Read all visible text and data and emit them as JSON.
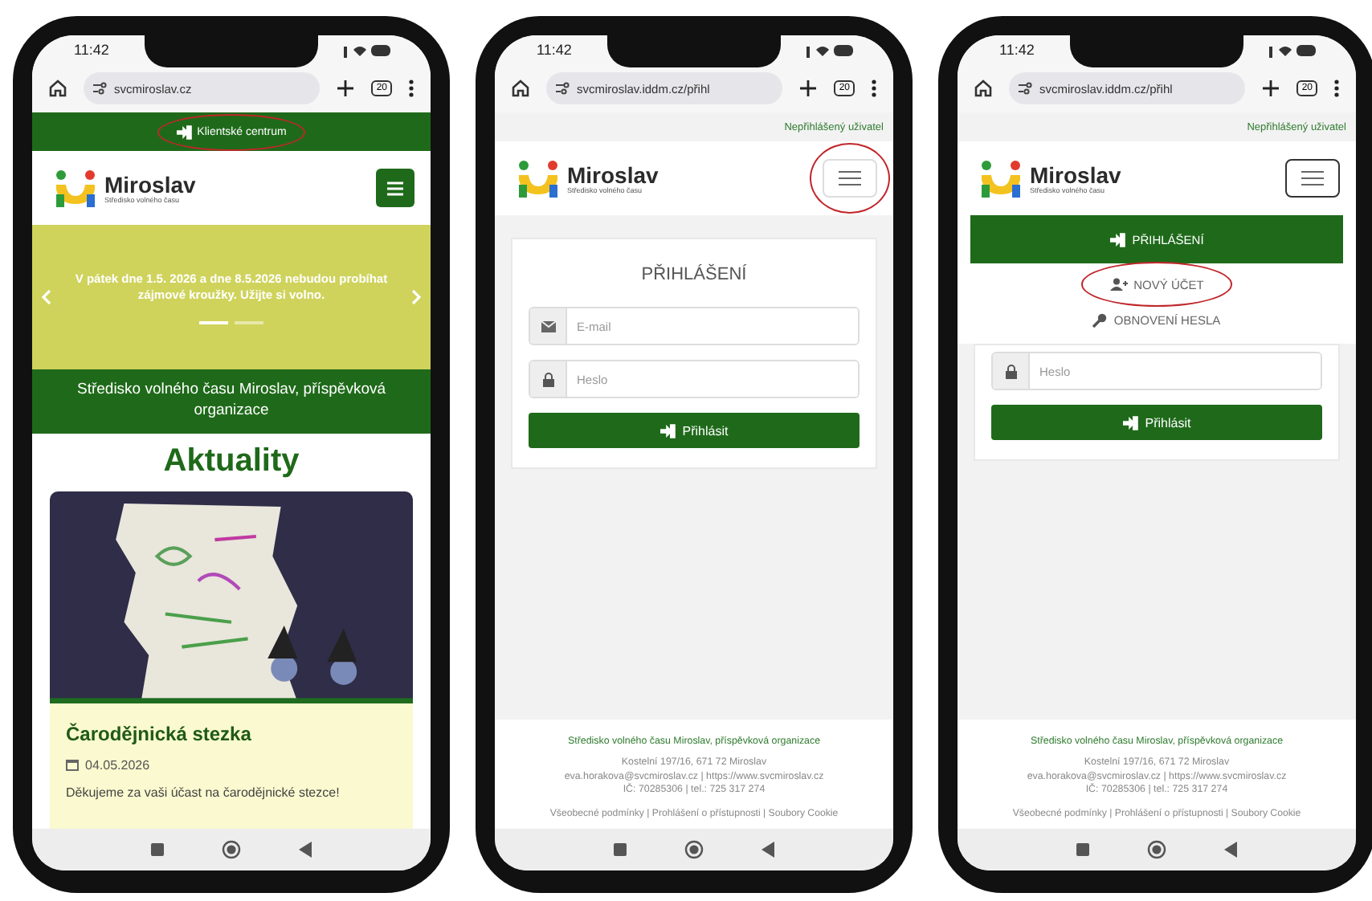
{
  "phones": [
    {
      "kind": "home",
      "time": "11:42",
      "url": "svcmiroslav.cz",
      "tab_count": "20",
      "top_link": {
        "label": "Klientské centrum",
        "highlighted": true
      },
      "logo": {
        "title": "Miroslav",
        "subtitle": "Středisko volného času"
      },
      "menu_button": {
        "highlighted": false
      },
      "banner": {
        "text": "V pátek dne 1.5. 2026 a dne 8.5.2026 nebudou probíhat zájmové kroužky. Užijte si volno.",
        "slides": [
          {
            "selected": true
          },
          {
            "selected": false
          }
        ]
      },
      "org_title": "Středisko volného času Miroslav, příspěvková organizace",
      "section_title": "Aktuality",
      "article": {
        "title": "Čarodějnická stezka",
        "date": "04.05.2026",
        "excerpt": "Děkujeme za vaši účast na čarodějnické stezce!"
      }
    },
    {
      "kind": "login",
      "time": "11:42",
      "url": "svcmiroslav.iddm.cz/přihl",
      "tab_count": "20",
      "user_status": "Nepřihlášený uživatel",
      "logo": {
        "title": "Miroslav",
        "subtitle": "Středisko volného času"
      },
      "menu_button": {
        "highlighted": true
      },
      "form": {
        "title": "PŘIHLÁŠENÍ",
        "fields": [
          {
            "kind": "email",
            "placeholder": "E-mail"
          },
          {
            "kind": "password",
            "placeholder": "Heslo"
          }
        ],
        "submit": "Přihlásit"
      },
      "footer": {
        "org": "Středisko volného času Miroslav, příspěvková organizace",
        "lines": [
          "Kostelní 197/16, 671 72 Miroslav",
          "eva.horakova@svcmiroslav.cz | https://www.svcmiroslav.cz",
          "IČ: 70285306 | tel.: 725 317 274"
        ],
        "links": "Všeobecné podmínky | Prohlášení o přístupnosti | Soubory Cookie"
      }
    },
    {
      "kind": "login",
      "time": "11:42",
      "url": "svcmiroslav.iddm.cz/přihl",
      "tab_count": "20",
      "user_status": "Nepřihlášený uživatel",
      "logo": {
        "title": "Miroslav",
        "subtitle": "Středisko volného času"
      },
      "menu_button": {
        "highlighted": false
      },
      "menu": [
        {
          "kind": "login",
          "label": "PŘIHLÁŠENÍ",
          "selected": true,
          "highlighted": false
        },
        {
          "kind": "user-add",
          "label": "NOVÝ ÚČET",
          "selected": false,
          "highlighted": true
        },
        {
          "kind": "key",
          "label": "OBNOVENÍ HESLA",
          "selected": false,
          "highlighted": false
        }
      ],
      "form": {
        "fields": [
          {
            "kind": "password",
            "placeholder": "Heslo"
          }
        ],
        "submit": "Přihlásit"
      },
      "footer": {
        "org": "Středisko volného času Miroslav, příspěvková organizace",
        "lines": [
          "Kostelní 197/16, 671 72 Miroslav",
          "eva.horakova@svcmiroslav.cz | https://www.svcmiroslav.cz",
          "IČ: 70285306 | tel.: 725 317 274"
        ],
        "links": "Všeobecné podmínky | Prohlášení o přístupnosti | Soubory Cookie"
      }
    }
  ]
}
